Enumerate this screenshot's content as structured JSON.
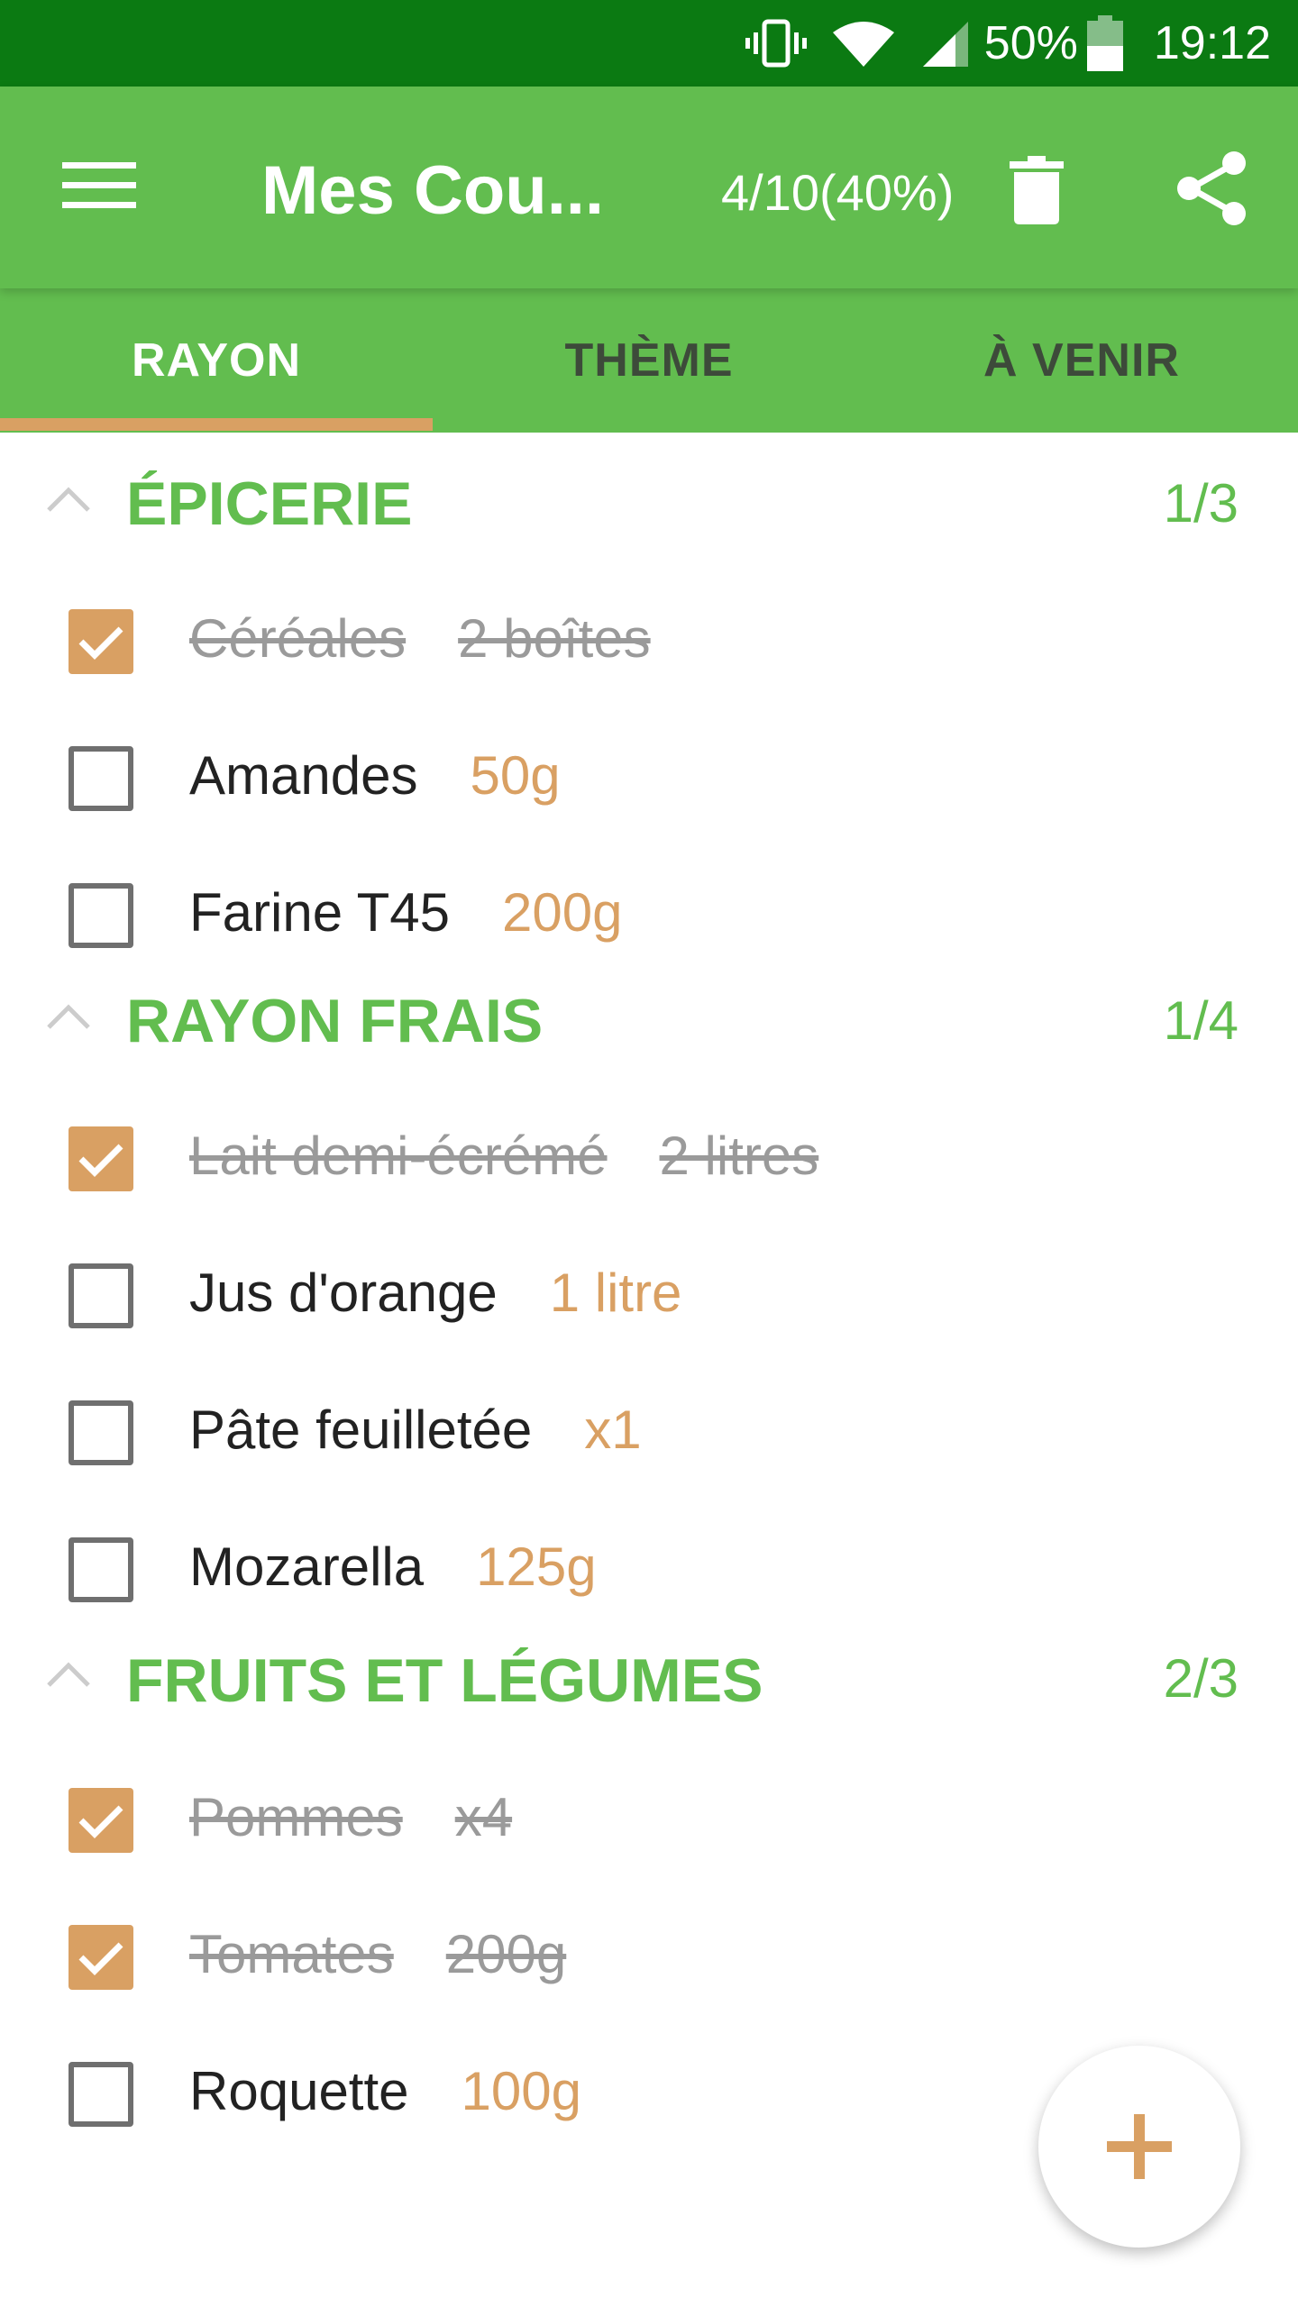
{
  "status_bar": {
    "battery_percent": "50%",
    "time": "19:12",
    "icons": [
      "vibrate-icon",
      "wifi-icon",
      "signal-icon",
      "battery-icon"
    ]
  },
  "app_bar": {
    "title": "Mes Cou...",
    "progress": "4/10(40%)",
    "icons": [
      "menu-icon",
      "trash-icon",
      "share-icon"
    ]
  },
  "tabs": [
    {
      "label": "RAYON",
      "active": true
    },
    {
      "label": "THÈME",
      "active": false
    },
    {
      "label": "À VENIR",
      "active": false
    }
  ],
  "sections": [
    {
      "title": "ÉPICERIE",
      "count": "1/3",
      "items": [
        {
          "name": "Céréales",
          "qty": "2 boîtes",
          "checked": true
        },
        {
          "name": "Amandes",
          "qty": "50g",
          "checked": false
        },
        {
          "name": "Farine T45",
          "qty": "200g",
          "checked": false
        }
      ]
    },
    {
      "title": "RAYON FRAIS",
      "count": "1/4",
      "items": [
        {
          "name": "Lait demi-écrémé",
          "qty": "2 litres",
          "checked": true
        },
        {
          "name": "Jus d'orange",
          "qty": "1 litre",
          "checked": false
        },
        {
          "name": "Pâte feuilletée",
          "qty": "x1",
          "checked": false
        },
        {
          "name": "Mozarella",
          "qty": "125g",
          "checked": false
        }
      ]
    },
    {
      "title": "FRUITS ET LÉGUMES",
      "count": "2/3",
      "items": [
        {
          "name": "Pommes",
          "qty": "x4",
          "checked": true
        },
        {
          "name": "Tomates",
          "qty": "200g",
          "checked": true
        },
        {
          "name": "Roquette",
          "qty": "100g",
          "checked": false
        }
      ]
    }
  ],
  "fab": {
    "icon": "plus-icon"
  },
  "colors": {
    "status_bar": "#0b7a12",
    "primary": "#62bd4f",
    "accent": "#d9a063",
    "text": "#222222",
    "done_text": "#9a9a9a"
  }
}
